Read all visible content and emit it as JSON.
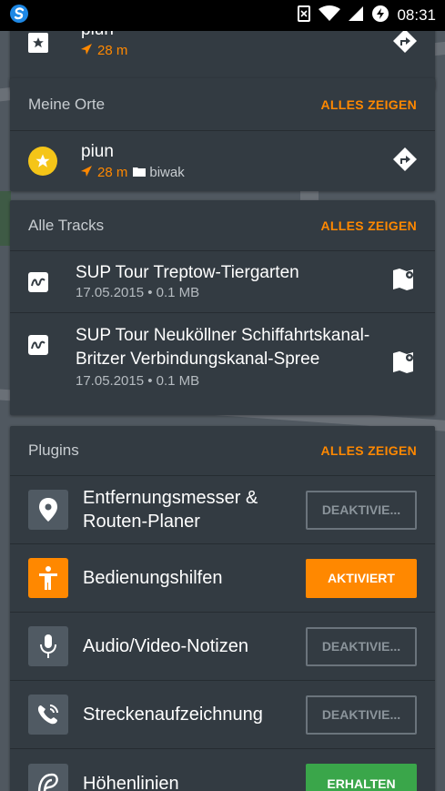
{
  "status": {
    "time": "08:31"
  },
  "top_partial": {
    "name": "piun",
    "distance": "28 m"
  },
  "my_places": {
    "title": "Meine Orte",
    "show_all": "ALLES ZEIGEN",
    "item": {
      "name": "piun",
      "distance": "28 m",
      "folder": "biwak"
    }
  },
  "all_tracks": {
    "title": "Alle Tracks",
    "show_all": "ALLES ZEIGEN",
    "items": [
      {
        "name": "SUP Tour Treptow-Tiergarten",
        "info": "17.05.2015 • 0.1 MB"
      },
      {
        "name": "SUP Tour Neuköllner Schiffahrtskanal-Britzer Verbindungskanal-Spree",
        "info": "17.05.2015 • 0.1 MB"
      }
    ]
  },
  "plugins": {
    "title": "Plugins",
    "show_all": "ALLES ZEIGEN",
    "items": [
      {
        "name": "Entfernungsmesser & Routen-Planer",
        "button": "DEAKTIVIE...",
        "icon": "location-pin-icon",
        "state": "off"
      },
      {
        "name": "Bedienungshilfen",
        "button": "AKTIVIERT",
        "icon": "accessibility-icon",
        "state": "on"
      },
      {
        "name": "Audio/Video-Notizen",
        "button": "DEAKTIVIE...",
        "icon": "microphone-icon",
        "state": "off"
      },
      {
        "name": "Streckenaufzeichnung",
        "button": "DEAKTIVIE...",
        "icon": "track-recording-icon",
        "state": "off"
      },
      {
        "name": "Höhenlinien",
        "button": "ERHALTEN",
        "icon": "contour-lines-icon",
        "state": "get"
      }
    ]
  },
  "colors": {
    "accent": "#ff8800",
    "card": "#333b42",
    "get": "#3aa64a",
    "favorite": "#f5c518"
  }
}
